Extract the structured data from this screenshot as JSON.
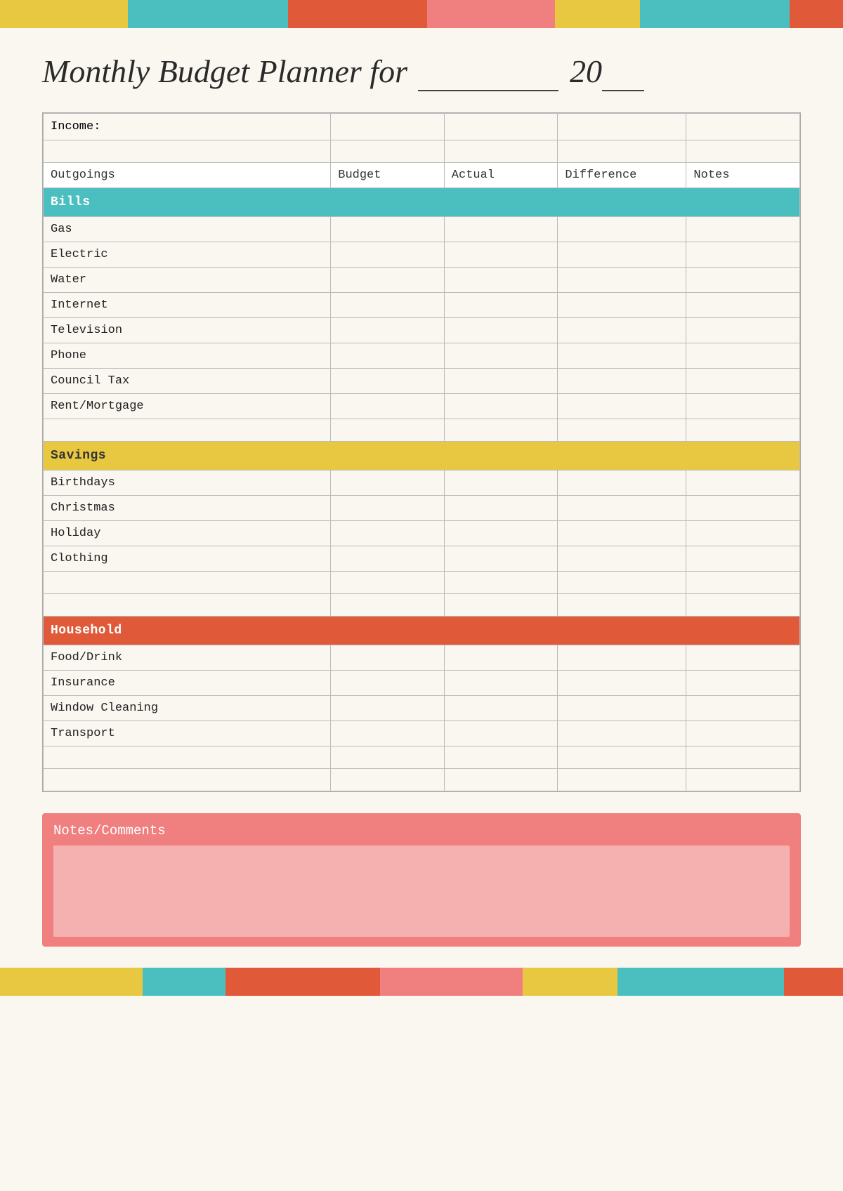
{
  "page": {
    "title_prefix": "Monthly Budget Planner for",
    "title_year_prefix": "20",
    "deco_top": [
      {
        "color": "#e8c840",
        "flex": 1.2
      },
      {
        "color": "#4bbfbf",
        "flex": 1.5
      },
      {
        "color": "#e05a3a",
        "flex": 1.3
      },
      {
        "color": "#f08080",
        "flex": 1.2
      },
      {
        "color": "#e8c840",
        "flex": 0.8
      },
      {
        "color": "#4bbfbf",
        "flex": 1.4
      },
      {
        "color": "#e05a3a",
        "flex": 0.5
      }
    ],
    "deco_bottom": [
      {
        "color": "#e8c840",
        "flex": 1.2
      },
      {
        "color": "#4bbfbf",
        "flex": 0.7
      },
      {
        "color": "#e05a3a",
        "flex": 1.3
      },
      {
        "color": "#f08080",
        "flex": 1.2
      },
      {
        "color": "#e8c840",
        "flex": 0.8
      },
      {
        "color": "#4bbfbf",
        "flex": 1.4
      },
      {
        "color": "#e05a3a",
        "flex": 0.5
      }
    ],
    "income_label": "Income:",
    "columns": {
      "outgoings": "Outgoings",
      "budget": "Budget",
      "actual": "Actual",
      "difference": "Difference",
      "notes": "Notes"
    },
    "sections": {
      "bills": {
        "label": "Bills",
        "color": "#4bbfbf",
        "items": [
          "Gas",
          "Electric",
          "Water",
          "Internet",
          "Television",
          "Phone",
          "Council Tax",
          "Rent/Mortgage"
        ]
      },
      "savings": {
        "label": "Savings",
        "color": "#e8c840",
        "items": [
          "Birthdays",
          "Christmas",
          "Holiday",
          "Clothing"
        ]
      },
      "household": {
        "label": "Household",
        "color": "#e05a3a",
        "items": [
          "Food/Drink",
          "Insurance",
          "Window Cleaning",
          "Transport"
        ]
      }
    },
    "notes_label": "Notes/Comments",
    "notes_bg": "#f08080"
  }
}
